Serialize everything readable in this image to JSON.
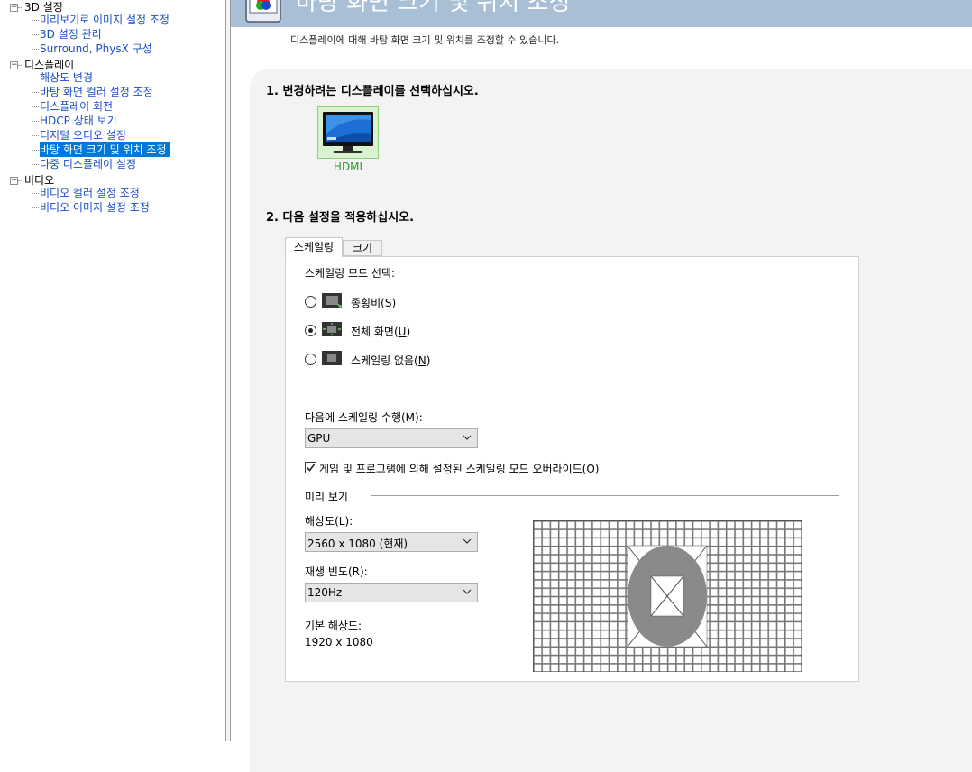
{
  "tree": {
    "categories": [
      {
        "label": "3D 설정",
        "items": [
          "미리보기로 이미지 설정 조정",
          "3D 설정 관리",
          "Surround, PhysX 구성"
        ]
      },
      {
        "label": "디스플레이",
        "items": [
          "해상도 변경",
          "바탕 화면 컬러 설정 조정",
          "디스플레이 회전",
          "HDCP 상태 보기",
          "디지털 오디오 설정",
          "바탕 화면 크기 및 위치 조정",
          "다중 디스플레이 설정"
        ]
      },
      {
        "label": "비디오",
        "items": [
          "비디오 컬러 설정 조정",
          "비디오 이미지 설정 조정"
        ]
      }
    ],
    "selected": "바탕 화면 크기 및 위치 조정"
  },
  "header": {
    "title": "바탕 화면 크기 및 위치 조정",
    "description": "디스플레이에 대해 바탕 화면 크기 및 위치를 조정할 수 있습니다."
  },
  "step1": {
    "label": "1. 변경하려는 디스플레이를 선택하십시오.",
    "display_name": "HDMI"
  },
  "step2": {
    "label": "2. 다음 설정을 적용하십시오."
  },
  "tabs": {
    "scaling": "스케일링",
    "size": "크기"
  },
  "scaling": {
    "mode_label": "스케일링 모드 선택:",
    "options": [
      {
        "label": "종횡비(",
        "key": "S",
        "selected": false
      },
      {
        "label": "전체 화면(",
        "key": "U",
        "selected": true
      },
      {
        "label": "스케일링 없음(",
        "key": "N",
        "selected": false
      }
    ],
    "perform_label": "다음에 스케일링 수행(M):",
    "perform_value": "GPU",
    "override_label": "게임 및 프로그램에 의해 설정된 스케일링 모드 오버라이드(O)",
    "override_checked": true
  },
  "preview": {
    "title": "미리 보기",
    "resolution_label": "해상도(L):",
    "resolution_value": "2560 x 1080 (현재)",
    "refresh_label": "재생 빈도(R):",
    "refresh_value": "120Hz",
    "native_label": "기본 해상도:",
    "native_value": "1920 x 1080"
  },
  "colors": {
    "accent": "#0078d7",
    "link": "#1a4dc5",
    "header": "#a8bfd6",
    "display_green": "#2a9c2a"
  }
}
